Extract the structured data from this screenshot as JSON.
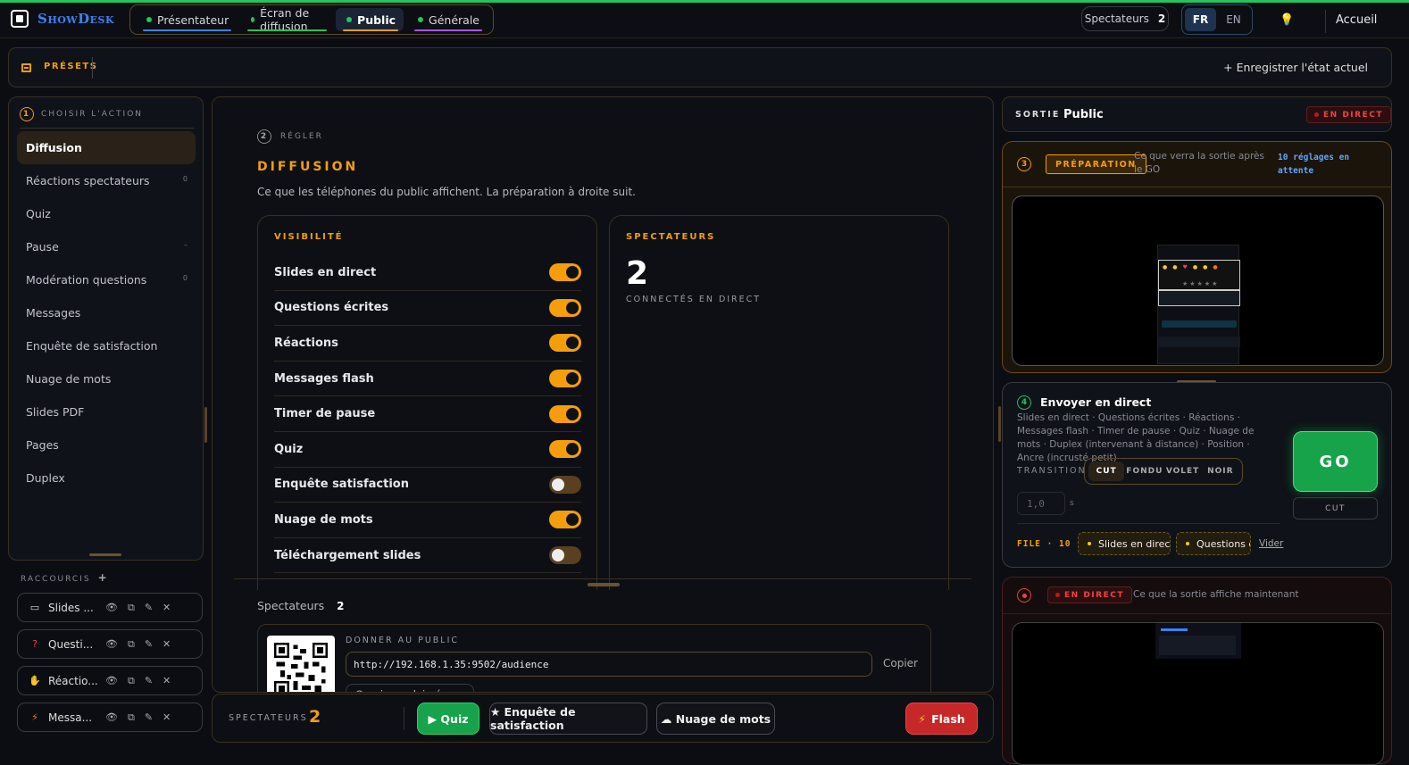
{
  "app": {
    "name": "ShowDesk"
  },
  "nav": {
    "tabs": [
      {
        "label": "Présentateur",
        "underline": "#3b82f6"
      },
      {
        "label": "Écran de diffusion",
        "underline": "#22c55e"
      },
      {
        "label": "Public",
        "underline": "#f59e0b",
        "active": true
      },
      {
        "label": "Générale",
        "underline": "#a855f7"
      }
    ],
    "spectators_label": "Spectateurs",
    "spectators_count": "2",
    "lang": {
      "fr": "FR",
      "en": "EN",
      "selected": "FR"
    },
    "home_label": "Accueil"
  },
  "presets": {
    "title": "PRÉSETS",
    "save_label": "+ Enregistrer l'état actuel"
  },
  "left": {
    "step": "1",
    "header": "CHOISIR L'ACTION",
    "items": [
      {
        "label": "Diffusion",
        "tag": ""
      },
      {
        "label": "Réactions spectateurs",
        "tag": "0"
      },
      {
        "label": "Quiz",
        "tag": ""
      },
      {
        "label": "Pause",
        "tag": "–"
      },
      {
        "label": "Modération questions",
        "tag": "0"
      },
      {
        "label": "Messages",
        "tag": ""
      },
      {
        "label": "Enquête de satisfaction",
        "tag": ""
      },
      {
        "label": "Nuage de mots",
        "tag": ""
      },
      {
        "label": "Slides PDF",
        "tag": ""
      },
      {
        "label": "Pages",
        "tag": ""
      },
      {
        "label": "Duplex",
        "tag": ""
      }
    ],
    "selected": "Diffusion"
  },
  "shortcuts": {
    "header": "RACCOURCIS",
    "add": "+",
    "items": [
      {
        "icon": "▭",
        "label": "Slides ..."
      },
      {
        "icon": "?",
        "label": "Questi..."
      },
      {
        "icon": "✋",
        "label": "Réactio..."
      },
      {
        "icon": "⚡",
        "label": "Messa..."
      }
    ]
  },
  "center": {
    "step": "2",
    "step_label": "RÉGLER",
    "title": "DIFFUSION",
    "desc": "Ce que les téléphones du public affichent. La préparation à droite suit.",
    "visibility_title": "VISIBILITÉ",
    "toggles": [
      {
        "label": "Slides en direct",
        "on": true
      },
      {
        "label": "Questions écrites",
        "on": true
      },
      {
        "label": "Réactions",
        "on": true
      },
      {
        "label": "Messages flash",
        "on": true
      },
      {
        "label": "Timer de pause",
        "on": true
      },
      {
        "label": "Quiz",
        "on": true
      },
      {
        "label": "Enquête satisfaction",
        "on": false
      },
      {
        "label": "Nuage de mots",
        "on": true
      },
      {
        "label": "Téléchargement slides",
        "on": false
      }
    ],
    "spectators_title": "SPECTATEURS",
    "spectators_count": "2",
    "spectators_sub": "CONNECTÉS EN DIRECT",
    "spect_row_label": "Spectateurs",
    "spect_row_count": "2",
    "give_label": "DONNER AU PUBLIC",
    "url": "http://192.168.1.35:9502/audience",
    "copy_label": "Copier",
    "open_full": "Ouvrir en plein écran"
  },
  "bottombar": {
    "label": "SPECTATEURS",
    "count": "2",
    "quiz": "▶ Quiz",
    "enquete": "★ Enquête de satisfaction",
    "nuage": "☁ Nuage de mots",
    "flash": "Flash"
  },
  "right": {
    "sortie_label": "SORTIE",
    "sortie_value": "Public",
    "live_badge": "EN DIRECT",
    "prep_step": "3",
    "prep_badge": "PRÉPARATION",
    "prep_desc": "Ce que verra la sortie après le GO",
    "prep_pending": "10 réglages en attente",
    "send_step": "4",
    "send_title": "Envoyer en direct",
    "send_desc": "Slides en direct · Questions écrites · Réactions · Messages flash · Timer de pause · Quiz · Nuage de mots · Duplex (intervenant à distance) · Position · Ancre (incrusté petit)",
    "go": "GO",
    "go_sub": "CUT",
    "transition_label": "TRANSITION",
    "transitions": [
      "CUT",
      "FONDU",
      "VOLET",
      "NOIR"
    ],
    "transition_selected": "CUT",
    "duration": "1,0",
    "duration_unit": "s",
    "file_label": "FILE · 10",
    "file_chips": [
      "Slides en direct",
      "Questions é"
    ],
    "clear_label": "Vider",
    "live_desc": "Ce que la sortie affiche maintenant"
  }
}
